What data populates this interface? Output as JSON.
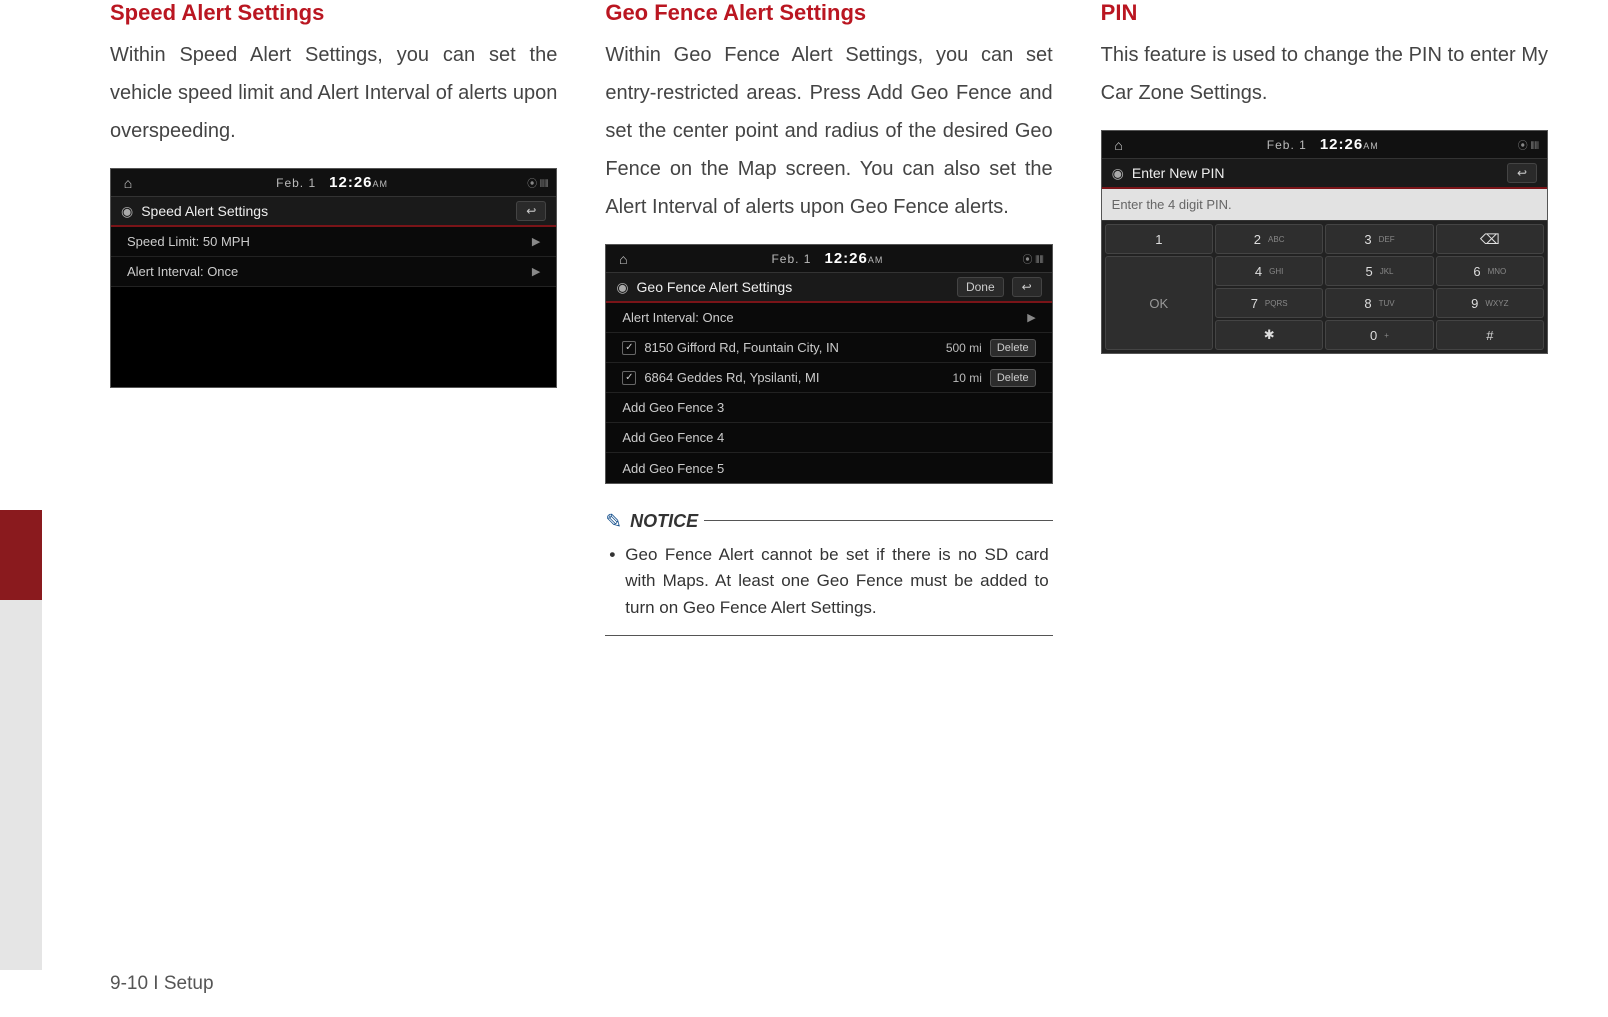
{
  "footer": "9-10 I Setup",
  "common_status": {
    "date": "Feb.  1",
    "time": "12:26",
    "ampm": "AM",
    "status_icons": "⦿ ⫴⫴"
  },
  "col1": {
    "heading": "Speed Alert Settings",
    "body": "Within Speed Alert Settings, you can set the vehicle speed limit and Alert Interval of alerts upon overspeeding.",
    "screen": {
      "title": "Speed Alert Settings",
      "rows": [
        {
          "label": "Speed Limit: 50 MPH"
        },
        {
          "label": "Alert Interval: Once"
        }
      ]
    }
  },
  "col2": {
    "heading": "Geo Fence Alert Settings",
    "body": "Within Geo Fence Alert Settings, you can set entry-restricted areas. Press Add Geo Fence and set the center point and radius of the desired Geo Fence on the Map screen. You can also set the Alert Interval of alerts upon Geo Fence alerts.",
    "screen": {
      "title": "Geo Fence Alert Settings",
      "done": "Done",
      "interval_label": "Alert Interval: Once",
      "fences": [
        {
          "addr": "8150 Gifford Rd, Fountain City, IN",
          "dist": "500 mi",
          "del": "Delete"
        },
        {
          "addr": "6864 Geddes Rd, Ypsilanti, MI",
          "dist": "10 mi",
          "del": "Delete"
        }
      ],
      "adds": [
        "Add Geo Fence 3",
        "Add Geo Fence 4",
        "Add Geo Fence 5"
      ]
    },
    "notice": {
      "title": "NOTICE",
      "text": "Geo Fence Alert cannot be set if there is no SD card with Maps. At least one Geo Fence must be added to turn on Geo Fence Alert Settings."
    }
  },
  "col3": {
    "heading": "PIN",
    "body": "This feature is used to change the PIN to enter My Car Zone Settings.",
    "screen": {
      "title": "Enter New PIN",
      "placeholder": "Enter the 4 digit PIN.",
      "keys": {
        "k1": "1",
        "k2": "2",
        "k2s": "ABC",
        "k3": "3",
        "k3s": "DEF",
        "k4": "4",
        "k4s": "GHI",
        "k5": "5",
        "k5s": "JKL",
        "k6": "6",
        "k6s": "MNO",
        "k7": "7",
        "k7s": "PQRS",
        "k8": "8",
        "k8s": "TUV",
        "k9": "9",
        "k9s": "WXYZ",
        "kstar": "✱",
        "k0": "0",
        "k0s": "+",
        "khash": "#",
        "back": "⌫",
        "ok": "OK"
      }
    }
  }
}
